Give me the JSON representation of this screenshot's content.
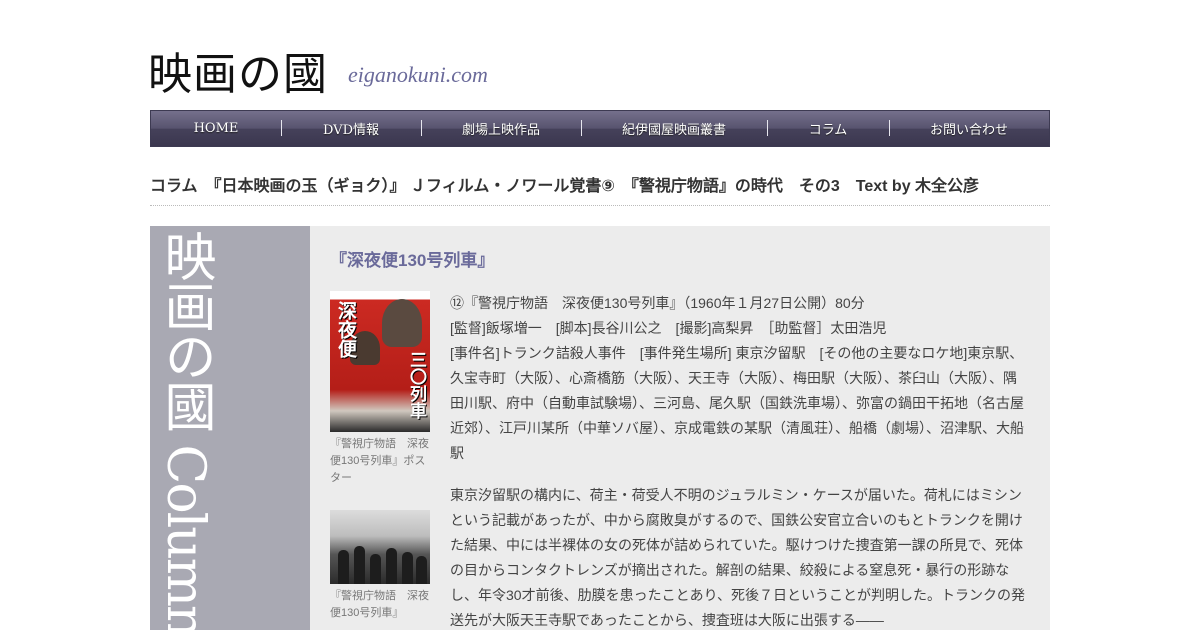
{
  "site": {
    "logo_kanji": "映画の國",
    "logo_roman": "eiganokuni.com"
  },
  "nav": [
    {
      "label": "HOME"
    },
    {
      "label": "DVD情報"
    },
    {
      "label": "劇場上映作品"
    },
    {
      "label": "紀伊國屋映画叢書"
    },
    {
      "label": "コラム"
    },
    {
      "label": "お問い合わせ"
    }
  ],
  "headline": "コラム　『日本映画の玉（ギョク）』 Ｊフィルム・ノワール覚書⑨　『警視庁物語』の時代　その3　Text by 木全公彦",
  "sidebar": {
    "vertical_text": "映画の國 Column"
  },
  "film": {
    "title": "『深夜便130号列車』",
    "poster_text_1": "深夜便",
    "poster_text_2": "三〇列車",
    "poster_caption": "『警視庁物語　深夜便130号列車』ポスター",
    "still_caption": "『警視庁物語　深夜便130号列車』",
    "paragraphs": [
      "⑫『警視庁物語　深夜便130号列車』（1960年１月27日公開）80分",
      "[監督]飯塚増一　[脚本]長谷川公之　[撮影]高梨昇　［助監督］太田浩児",
      "[事件名]トランク詰殺人事件　[事件発生場所] 東京汐留駅　[その他の主要なロケ地]東京駅、久宝寺町（大阪）、心斎橋筋（大阪）、天王寺（大阪）、梅田駅（大阪）、茶臼山（大阪）、隅田川駅、府中（自動車試験場）、三河島、尾久駅（国鉄洗車場）、弥富の鍋田干拓地（名古屋近郊）、江戸川某所（中華ソバ屋）、京成電鉄の某駅（清風荘）、船橋（劇場）、沼津駅、大船駅",
      "東京汐留駅の構内に、荷主・荷受人不明のジュラルミン・ケースが届いた。荷札にはミシンという記載があったが、中から腐敗臭がするので、国鉄公安官立合いのもとトランクを開けた結果、中には半裸体の女の死体が詰められていた。駆けつけた捜査第一課の所見で、死体の目からコンタクトレンズが摘出された。解剖の結果、絞殺による窒息死・暴行の形跡なし、年令30才前後、肋膜を患ったことあり、死後７日ということが判明した。トランクの発送先が大阪天王寺駅であったことから、捜査班は大阪に出張する――"
    ]
  }
}
